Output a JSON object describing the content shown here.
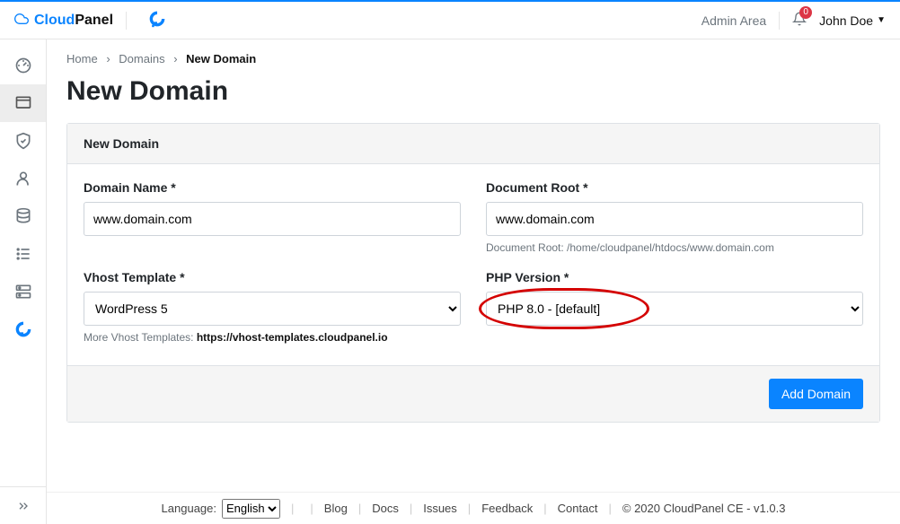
{
  "brand": {
    "cloud": "Cloud",
    "panel": "Panel"
  },
  "header": {
    "admin_area": "Admin Area",
    "notifications_count": "0",
    "user_name": "John Doe"
  },
  "breadcrumb": {
    "home": "Home",
    "domains": "Domains",
    "current": "New Domain"
  },
  "page": {
    "title": "New Domain"
  },
  "card": {
    "title": "New Domain",
    "domain_name_label": "Domain Name *",
    "domain_name_value": "www.domain.com",
    "document_root_label": "Document Root *",
    "document_root_value": "www.domain.com",
    "document_root_help": "Document Root: /home/cloudpanel/htdocs/www.domain.com",
    "vhost_label": "Vhost Template *",
    "vhost_options": [
      "WordPress 5"
    ],
    "vhost_selected": "WordPress 5",
    "vhost_help_prefix": "More Vhost Templates: ",
    "vhost_help_link": "https://vhost-templates.cloudpanel.io",
    "php_label": "PHP Version *",
    "php_options": [
      "PHP 8.0 - [default]"
    ],
    "php_selected": "PHP 8.0 - [default]",
    "submit_label": "Add Domain"
  },
  "footer": {
    "language_label": "Language:",
    "language_selected": "English",
    "links": {
      "blog": "Blog",
      "docs": "Docs",
      "issues": "Issues",
      "feedback": "Feedback",
      "contact": "Contact"
    },
    "copyright": "© 2020 CloudPanel CE - v1.0.3"
  }
}
